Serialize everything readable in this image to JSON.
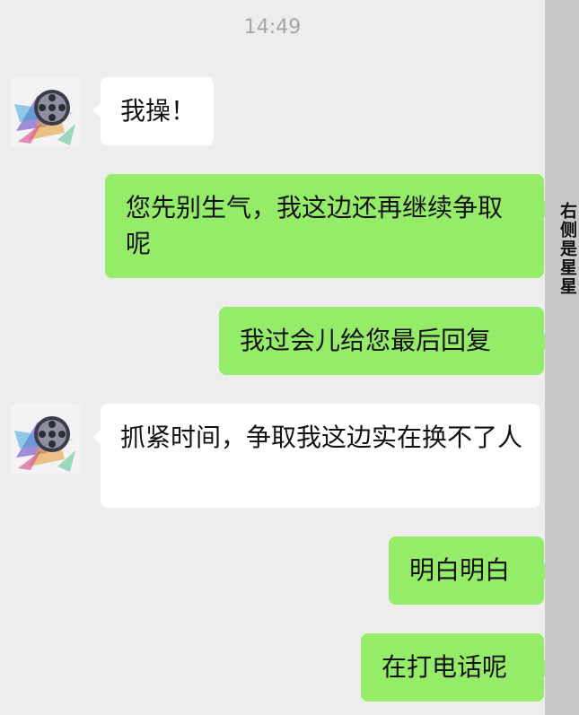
{
  "chat": {
    "timestamp": "14:49",
    "messages": [
      {
        "side": "in",
        "text": "我操！"
      },
      {
        "side": "out",
        "text": "您先别生气，我这边还再继续争取呢"
      },
      {
        "side": "out",
        "text": "我过会儿给您最后回复"
      },
      {
        "side": "in",
        "text": "抓紧时间，争取我这边实在换不了人"
      },
      {
        "side": "out",
        "text": "明白明白"
      },
      {
        "side": "out",
        "text": "在打电话呢"
      }
    ]
  },
  "side_panel": {
    "label": "右侧是星星"
  },
  "colors": {
    "background": "#ededed",
    "incoming_bubble": "#ffffff",
    "outgoing_bubble": "#95ec69",
    "timestamp_text": "#a6a6a6",
    "side_strip": "#c8c8c8"
  },
  "icons": {
    "contact_avatar": "film-reel-avatar-icon"
  }
}
